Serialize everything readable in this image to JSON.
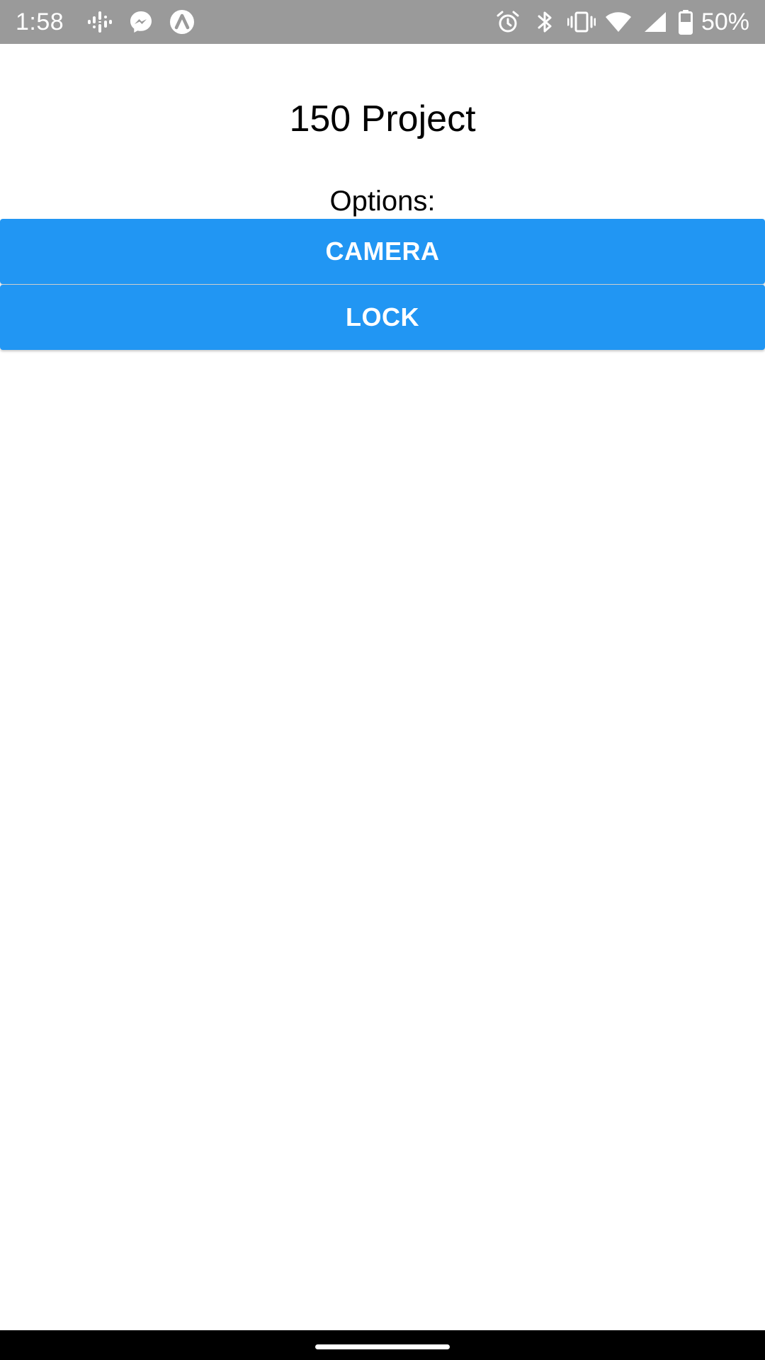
{
  "status_bar": {
    "time": "1:58",
    "battery_percent": "50%",
    "background_color": "#9a9a9a",
    "left_icons": [
      "podcasts-icon",
      "messenger-icon",
      "app-notification-icon"
    ],
    "right_icons": [
      "alarm-icon",
      "bluetooth-icon",
      "vibrate-icon",
      "wifi-icon",
      "cellular-signal-icon",
      "battery-icon"
    ]
  },
  "main": {
    "title": "150 Project",
    "options_label": "Options:",
    "buttons": [
      {
        "label": "CAMERA",
        "color": "#2196f3"
      },
      {
        "label": "LOCK",
        "color": "#2196f3"
      }
    ]
  },
  "nav_bar": {
    "background_color": "#000000",
    "home_indicator": "home-pill"
  }
}
